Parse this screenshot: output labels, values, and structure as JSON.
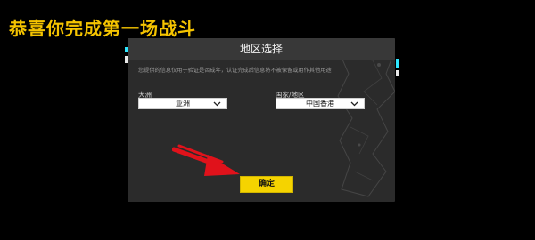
{
  "banner": {
    "text": "恭喜你完成第一场战斗"
  },
  "dialog": {
    "title": "地区选择",
    "notice": "您提供的信息仅用于验证是否成年，认证完成后信息将不被保留或用作其他用途",
    "continent": {
      "label": "大洲",
      "value": "亚洲"
    },
    "region": {
      "label": "国家/地区",
      "value": "中国香港"
    },
    "confirm_label": "确定"
  },
  "colors": {
    "accent": "#f5c400",
    "arrow": "#e0121b"
  }
}
